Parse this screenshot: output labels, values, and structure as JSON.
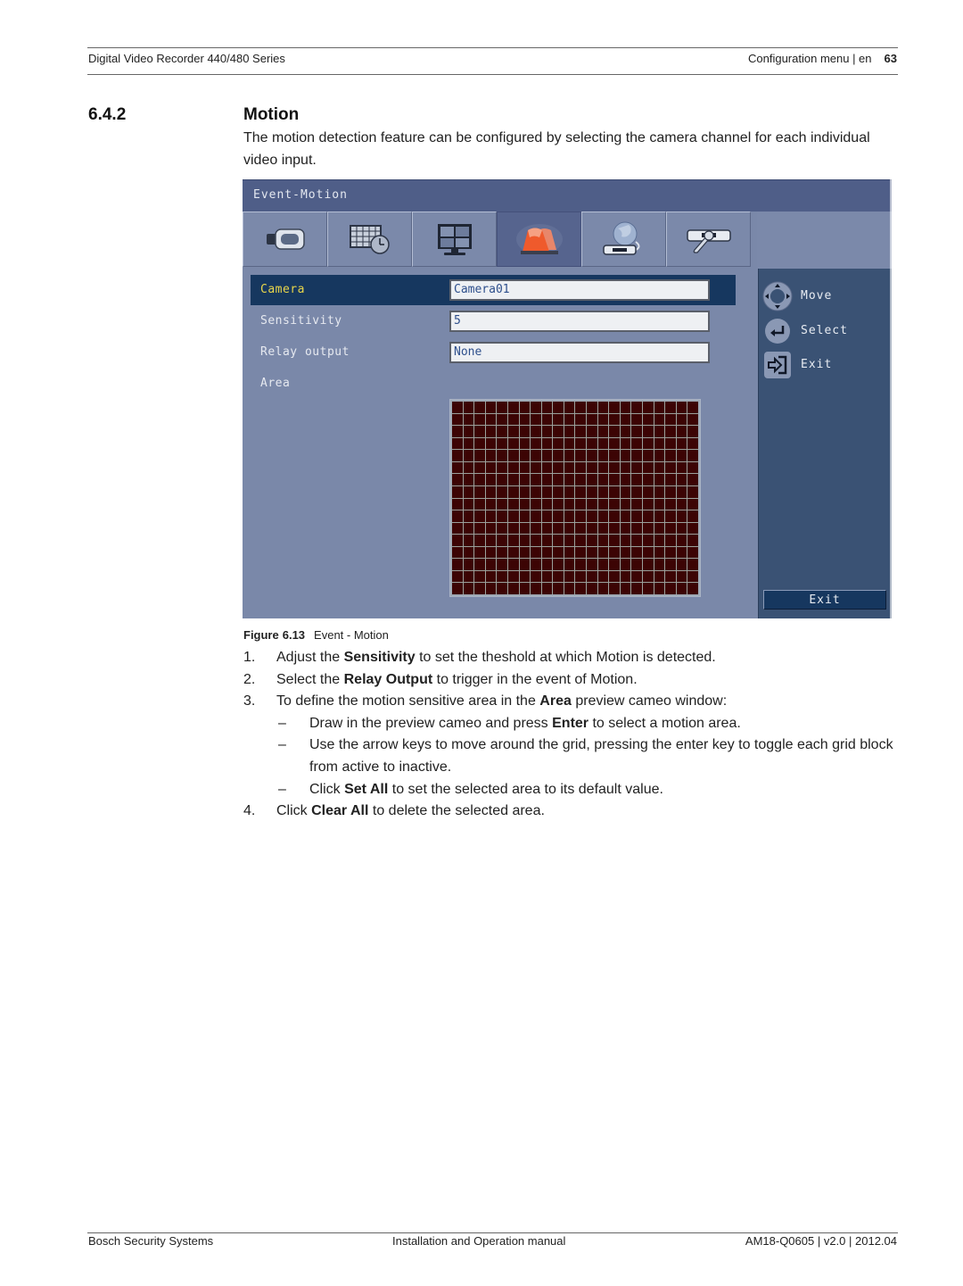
{
  "header": {
    "left": "Digital Video Recorder 440/480 Series",
    "section": "Configuration menu | en",
    "page_number": "63"
  },
  "section": {
    "number": "6.4.2",
    "title": "Motion",
    "intro": "The motion detection feature can be configured by selecting the camera channel for each individual video input."
  },
  "dvr_ui": {
    "window_title": "Event-Motion",
    "tabs": [
      {
        "icon": "camera-icon",
        "active": false
      },
      {
        "icon": "schedule-icon",
        "active": false
      },
      {
        "icon": "display-icon",
        "active": false
      },
      {
        "icon": "alarm-light-icon",
        "active": true
      },
      {
        "icon": "network-icon",
        "active": false
      },
      {
        "icon": "system-tools-icon",
        "active": false
      }
    ],
    "rows": [
      {
        "label": "Camera",
        "value": "Camera01",
        "selected": true
      },
      {
        "label": "Sensitivity",
        "value": "5",
        "selected": false
      },
      {
        "label": "Relay output",
        "value": "None",
        "selected": false
      },
      {
        "label": "Area"
      }
    ],
    "area_grid": {
      "columns": 22,
      "rows": 16,
      "cell_color": "#3c0404",
      "line_color": "#9aa09b"
    },
    "hints": [
      {
        "icon": "directional-pad-icon",
        "label": "Move"
      },
      {
        "icon": "enter-icon",
        "label": "Select"
      },
      {
        "icon": "exit-door-icon",
        "label": "Exit"
      }
    ],
    "exit_button": "Exit",
    "colors": {
      "title_bar": "#4f5e88",
      "panel": "#7a88a9",
      "sidebar": "#3a5274",
      "selected_row": "#16375f",
      "selected_label": "#e9d64a"
    }
  },
  "figure": {
    "label": "Figure",
    "number": "6.13",
    "caption": "Event - Motion"
  },
  "steps": [
    {
      "n": "1.",
      "parts": [
        [
          "Adjust the ",
          false
        ],
        [
          "Sensitivity",
          true
        ],
        [
          " to set the theshold at which Motion is detected.",
          false
        ]
      ]
    },
    {
      "n": "2.",
      "parts": [
        [
          "Select the ",
          false
        ],
        [
          "Relay Output",
          true
        ],
        [
          " to trigger in the event of Motion.",
          false
        ]
      ]
    },
    {
      "n": "3.",
      "parts": [
        [
          "To define the motion sensitive area in the ",
          false
        ],
        [
          "Area",
          true
        ],
        [
          " preview cameo window:",
          false
        ]
      ],
      "subs": [
        {
          "d": "–",
          "parts": [
            [
              "Draw in the preview cameo and press ",
              false
            ],
            [
              "Enter",
              true
            ],
            [
              " to select a motion area.",
              false
            ]
          ]
        },
        {
          "d": "–",
          "parts": [
            [
              "Use the arrow keys to move around the grid, pressing the enter key to toggle each grid block from active to inactive.",
              false
            ]
          ]
        },
        {
          "d": "–",
          "parts": [
            [
              "Click ",
              false
            ],
            [
              "Set All",
              true
            ],
            [
              " to set the selected area to its default value.",
              false
            ]
          ]
        }
      ]
    },
    {
      "n": "4.",
      "parts": [
        [
          "Click ",
          false
        ],
        [
          "Clear All",
          true
        ],
        [
          " to delete the selected area.",
          false
        ]
      ]
    }
  ],
  "footer": {
    "left": "Bosch Security Systems",
    "center": "Installation and Operation manual",
    "right": "AM18-Q0605 | v2.0 | 2012.04"
  }
}
